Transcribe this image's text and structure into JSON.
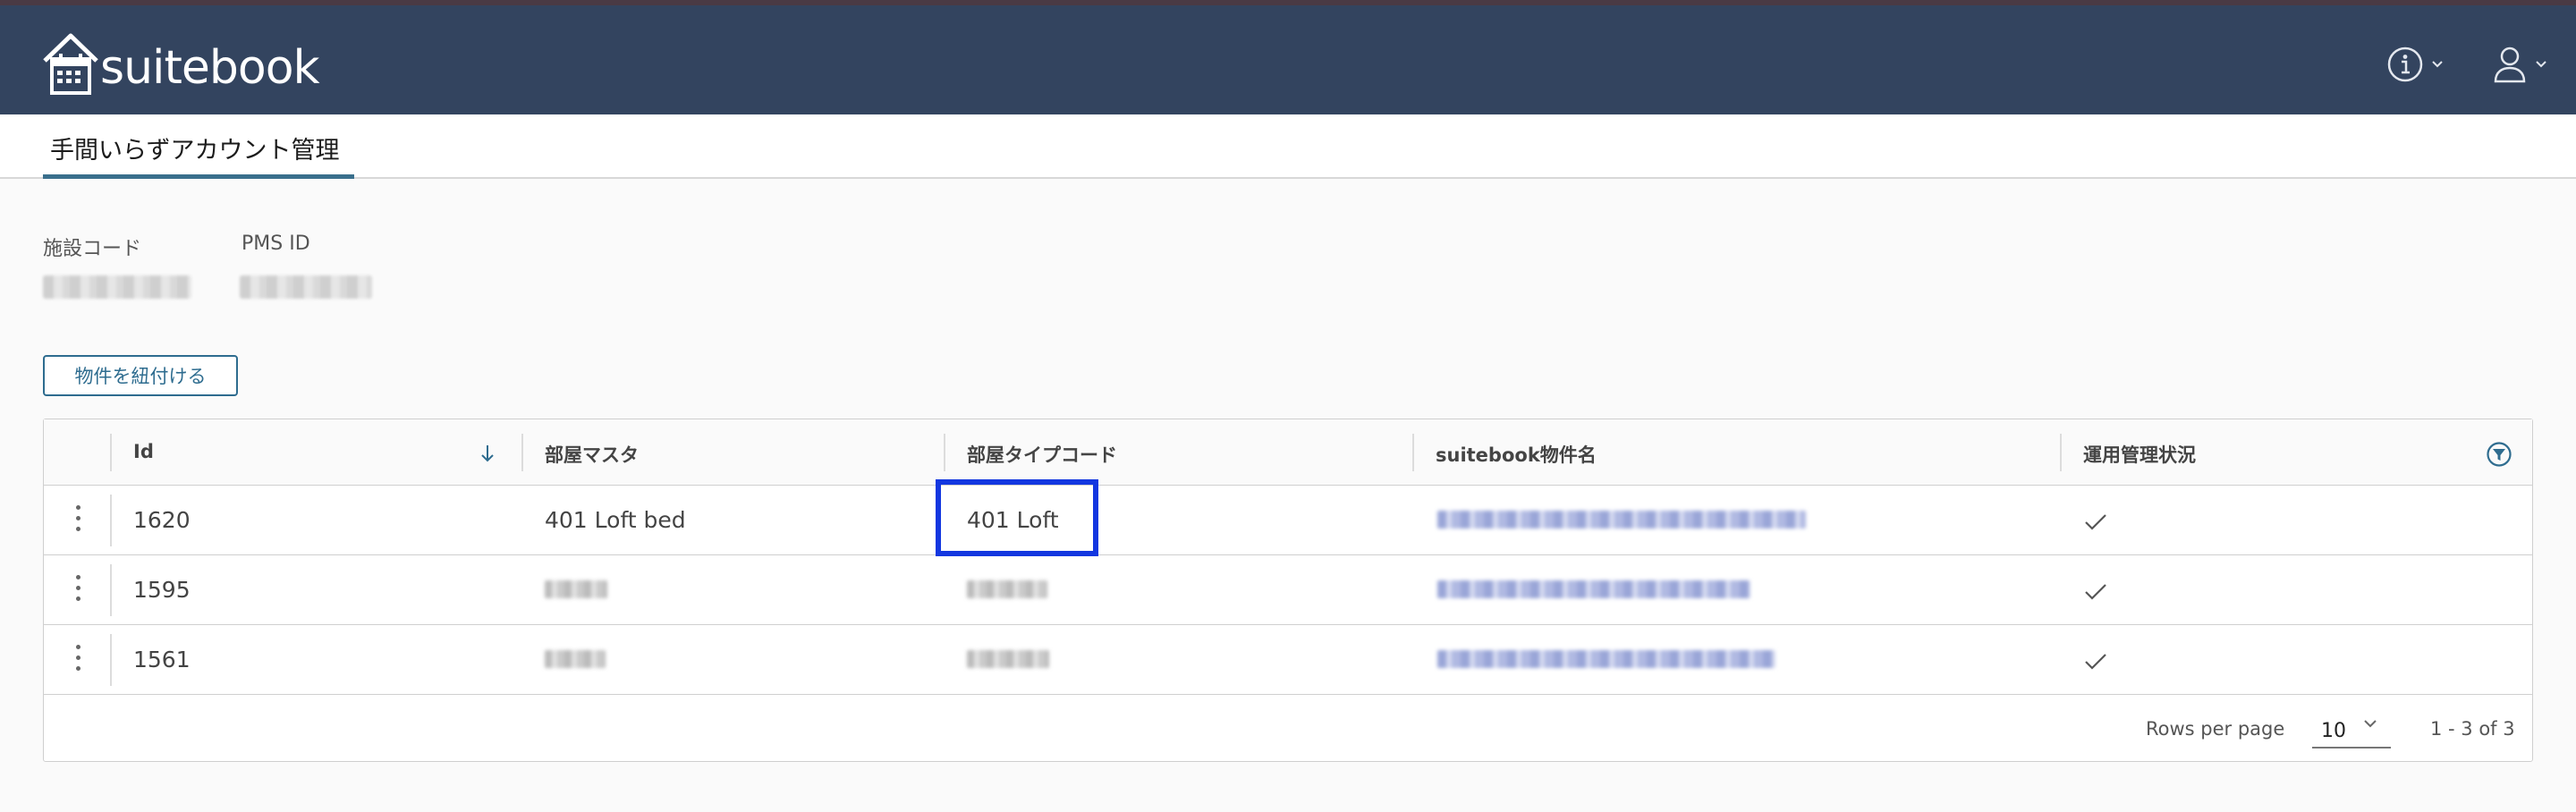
{
  "app": {
    "brand": "suitebook"
  },
  "tabs": [
    {
      "label": "手間いらずアカウント管理",
      "active": true
    }
  ],
  "fields": [
    {
      "label": "施設コード"
    },
    {
      "label": "PMS ID"
    }
  ],
  "actions": {
    "link_button": "物件を紐付ける"
  },
  "table": {
    "columns": [
      "Id",
      "部屋マスタ",
      "部屋タイプコード",
      "suitebook物件名",
      "運用管理状況"
    ],
    "sort": {
      "column": "Id",
      "direction": "desc"
    },
    "rows": [
      {
        "id": "1620",
        "room_master": "401 Loft bed",
        "room_type_code": "401 Loft",
        "managed": true
      },
      {
        "id": "1595",
        "managed": true
      },
      {
        "id": "1561",
        "managed": true
      }
    ],
    "footer": {
      "rows_per_page_label": "Rows per page",
      "rows_per_page": "10",
      "range": "1 - 3 of 3"
    }
  },
  "icons": [
    "home-calendar-logo-icon",
    "info-icon",
    "user-icon",
    "chevron-down-icon",
    "sort-arrow-down-icon",
    "filter-icon",
    "kebab-menu-icon",
    "check-icon"
  ],
  "colors": {
    "header_bg": "#33445f",
    "accent": "#2e6c8f",
    "highlight": "#1337e0"
  }
}
